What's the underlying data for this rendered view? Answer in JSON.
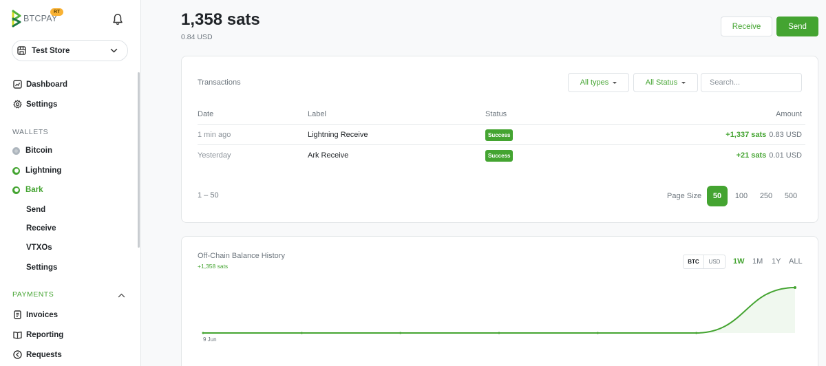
{
  "brand": {
    "name": "BTCPAY",
    "badge": "RT"
  },
  "store": {
    "name": "Test Store"
  },
  "nav": {
    "dashboard": "Dashboard",
    "settings": "Settings",
    "wallets_header": "WALLETS",
    "bitcoin": "Bitcoin",
    "lightning": "Lightning",
    "bark": "Bark",
    "bark_send": "Send",
    "bark_receive": "Receive",
    "bark_vtxos": "VTXOs",
    "bark_settings": "Settings",
    "payments_header": "PAYMENTS",
    "invoices": "Invoices",
    "reporting": "Reporting",
    "requests": "Requests"
  },
  "header": {
    "balance": "1,358 sats",
    "balance_usd": "0.84 USD",
    "receive_label": "Receive",
    "send_label": "Send"
  },
  "transactions": {
    "title": "Transactions",
    "type_filter": "All types",
    "status_filter": "All Status",
    "search_placeholder": "Search...",
    "columns": {
      "date": "Date",
      "label": "Label",
      "status": "Status",
      "amount": "Amount"
    },
    "rows": [
      {
        "date": "1 min ago",
        "label": "Lightning Receive",
        "status": "Success",
        "amount_sats": "+1,337 sats",
        "amount_usd": "0.83 USD"
      },
      {
        "date": "Yesterday",
        "label": "Ark Receive",
        "status": "Success",
        "amount_sats": "+21 sats",
        "amount_usd": "0.01 USD"
      }
    ],
    "range": "1 – 50",
    "page_size_label": "Page Size",
    "page_sizes": [
      "50",
      "100",
      "250",
      "500"
    ],
    "page_size_selected": "50"
  },
  "balance_history": {
    "title": "Off-Chain Balance History",
    "change": "+1,358 sats",
    "units": [
      "BTC",
      "USD"
    ],
    "unit_selected": "BTC",
    "periods": [
      "1W",
      "1M",
      "1Y",
      "ALL"
    ],
    "period_selected": "1W",
    "x_label": "9 Jun",
    "accent_color": "#44a431"
  },
  "chart_data": {
    "type": "area",
    "title": "Off-Chain Balance History",
    "x": [
      0,
      1,
      2,
      3,
      4,
      5,
      6
    ],
    "values": [
      0,
      0,
      0,
      0,
      0,
      1,
      1358
    ],
    "tick_labels": [
      "9 Jun"
    ],
    "grid": false
  },
  "colors": {
    "accent": "#44a431",
    "muted": "#6c757d",
    "border": "#dee2e6"
  }
}
